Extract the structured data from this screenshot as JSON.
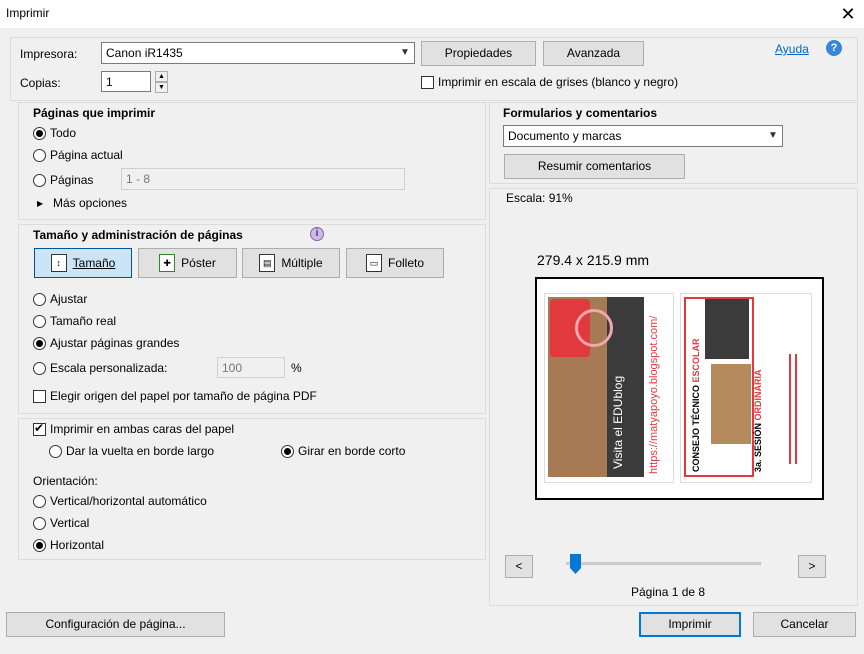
{
  "window": {
    "title": "Imprimir",
    "close_glyph": "✕"
  },
  "printer": {
    "label": "Impresora:",
    "selected": "Canon iR1435",
    "properties_button": "Propiedades",
    "advanced_button": "Avanzada",
    "help_link": "Ayuda",
    "help_glyph": "?",
    "copies_label": "Copias:",
    "copies_value": "1",
    "grayscale_label": "Imprimir en escala de grises (blanco y negro)",
    "grayscale_checked": false
  },
  "pages": {
    "heading": "Páginas que imprimir",
    "options": [
      {
        "label": "Todo",
        "selected": true
      },
      {
        "label": "Página actual",
        "selected": false
      },
      {
        "label": "Páginas",
        "selected": false
      }
    ],
    "range_value": "1 - 8",
    "more_options": "Más opciones",
    "more_glyph": "▶"
  },
  "sizing": {
    "heading": "Tamaño y administración de páginas",
    "info_glyph": "i",
    "tabs": [
      {
        "label": "Tamaño",
        "selected": true
      },
      {
        "label": "Póster",
        "selected": false
      },
      {
        "label": "Múltiple",
        "selected": false
      },
      {
        "label": "Folleto",
        "selected": false
      }
    ],
    "options": [
      {
        "label": "Ajustar",
        "selected": false
      },
      {
        "label": "Tamaño real",
        "selected": false
      },
      {
        "label": "Ajustar páginas grandes",
        "selected": true
      },
      {
        "label": "Escala personalizada:",
        "selected": false
      }
    ],
    "custom_scale_value": "100",
    "percent": "%",
    "paper_source_label": "Elegir origen del papel por tamaño de página PDF",
    "paper_source_checked": false
  },
  "duplex": {
    "label": "Imprimir en ambas caras del papel",
    "checked": true,
    "flip_long": "Dar la vuelta en borde largo",
    "flip_long_selected": false,
    "flip_short": "Girar en borde corto",
    "flip_short_selected": true
  },
  "orientation": {
    "heading": "Orientación:",
    "options": [
      {
        "label": "Vertical/horizontal automático",
        "selected": false
      },
      {
        "label": "Vertical",
        "selected": false
      },
      {
        "label": "Horizontal",
        "selected": true
      }
    ]
  },
  "comments": {
    "heading": "Formularios y comentarios",
    "selected": "Documento y marcas",
    "summarize_button": "Resumir comentarios"
  },
  "preview": {
    "scale_label": "Escala:",
    "scale_value": "91%",
    "dimensions": "279.4 x 215.9 mm",
    "prev_glyph": "<",
    "next_glyph": ">",
    "slider_position": 0.0,
    "page_indicator": "Página 1 de 8",
    "left_page": {
      "url_text": "https://matyapoyo.blogspot.com/",
      "visit_text": "Visita el EDUblog"
    },
    "right_page": {
      "title_main": "CONSEJO TÉCNICO",
      "title_accent": "ESCOLAR",
      "session_text": "3a. SESIÓN",
      "session_accent": "ORDINARIA"
    },
    "accent_color": "#e0393e"
  },
  "footer": {
    "page_setup_button": "Configuración de página...",
    "print_button": "Imprimir",
    "cancel_button": "Cancelar"
  }
}
